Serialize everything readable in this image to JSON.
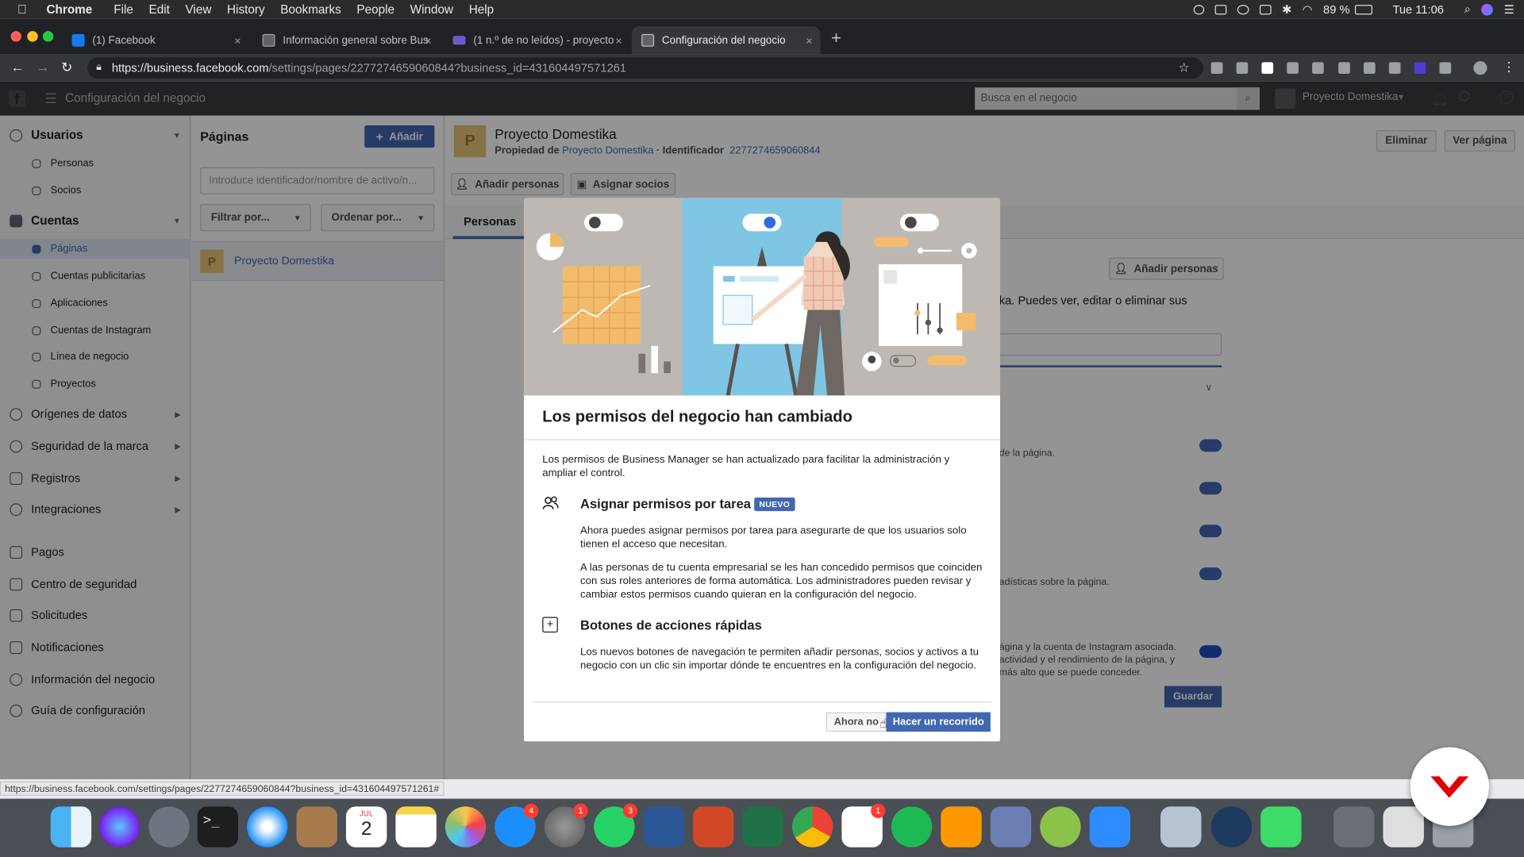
{
  "menubar": {
    "apple": "",
    "items": [
      "Chrome",
      "File",
      "Edit",
      "View",
      "History",
      "Bookmarks",
      "People",
      "Window",
      "Help"
    ],
    "battery": "89 %",
    "clock": "Tue 11:06"
  },
  "tabs": [
    {
      "label": "(1) Facebook",
      "close": "×"
    },
    {
      "label": "Información general sobre Bus",
      "close": "×"
    },
    {
      "label": "(1 n.º de no leídos) - proyecto",
      "close": "×"
    },
    {
      "label": "Configuración del negocio",
      "close": "×"
    }
  ],
  "new_tab": "+",
  "address": {
    "host": "https://business.facebook.com",
    "path": "/settings/pages/2277274659060844?business_id=431604497571261"
  },
  "fb_header": {
    "title": "Configuración del negocio",
    "search_placeholder": "Busca en el negocio",
    "business_name": "Proyecto Domestika"
  },
  "sidebar": {
    "users_section": "Usuarios",
    "users_items": [
      "Personas",
      "Socios"
    ],
    "accounts_section": "Cuentas",
    "accounts_items": [
      "Páginas",
      "Cuentas publicitarias",
      "Aplicaciones",
      "Cuentas de Instagram",
      "Línea de negocio",
      "Proyectos"
    ],
    "other_sections": [
      "Orígenes de datos",
      "Seguridad de la marca",
      "Registros",
      "Integraciones"
    ],
    "plain_items": [
      "Pagos",
      "Centro de seguridad",
      "Solicitudes",
      "Notificaciones",
      "Información del negocio",
      "Guía de configuración"
    ]
  },
  "pages_panel": {
    "title": "Páginas",
    "add_label": "Añadir",
    "search_placeholder": "Introduce identificador/nombre de activo/n...",
    "filter_label": "Filtrar por...",
    "sort_label": "Ordenar por...",
    "page_initial": "P",
    "page_name": "Proyecto Domestika"
  },
  "main": {
    "page_initial": "P",
    "page_name": "Proyecto Domestika",
    "owner_label": "Propiedad de",
    "owner_name": "Proyecto Domestika",
    "id_label": "· Identificador",
    "id_value": "2277274659060844",
    "delete_label": "Eliminar",
    "view_label": "Ver página",
    "add_people": "Añadir personas",
    "assign_partners": "Asignar socios",
    "tab_people": "Personas",
    "add_people_2": "Añadir personas",
    "partial_desc": "ka. Puedes ver, editar o eliminar sus",
    "perm1": "de la página.",
    "perm4": "adísticas sobre la página.",
    "perm5_l1": "ágina y la cuenta de Instagram asociada.",
    "perm5_l2": "actividad y el rendimiento de la página, y",
    "perm5_l3": "más alto que se puede conceder.",
    "save_label": "Guardar"
  },
  "status_url": "https://business.facebook.com/settings/pages/2277274659060844?business_id=431604497571261#",
  "modal": {
    "title": "Los permisos del negocio han cambiado",
    "intro": "Los permisos de Business Manager se han actualizado para facilitar la administración y ampliar el control.",
    "s1_title": "Asignar permisos por tarea",
    "s1_badge": "NUEVO",
    "s1_p1": "Ahora puedes asignar permisos por tarea para asegurarte de que los usuarios solo tienen el acceso que necesitan.",
    "s1_p2": "A las personas de tu cuenta empresarial se les han concedido permisos que coinciden con sus roles anteriores de forma automática. Los administradores pueden revisar y cambiar estos permisos cuando quieran en la configuración del negocio.",
    "s2_title": "Botones de acciones rápidas",
    "s2_p1": "Los nuevos botones de navegación te permiten añadir personas, socios y activos a tu negocio con un clic sin importar dónde te encuentres en la configuración del negocio.",
    "btn_not_now": "Ahora no",
    "btn_tour": "Hacer un recorrido"
  },
  "dock": {
    "badges": [
      "4",
      "1",
      "3",
      "1"
    ],
    "calendar_month": "JUL",
    "calendar_day": "2"
  },
  "colors": {
    "fb_blue": "#4267b2",
    "overlay": "rgba(0,0,0,0.42)",
    "brand_red": "#e00000"
  }
}
